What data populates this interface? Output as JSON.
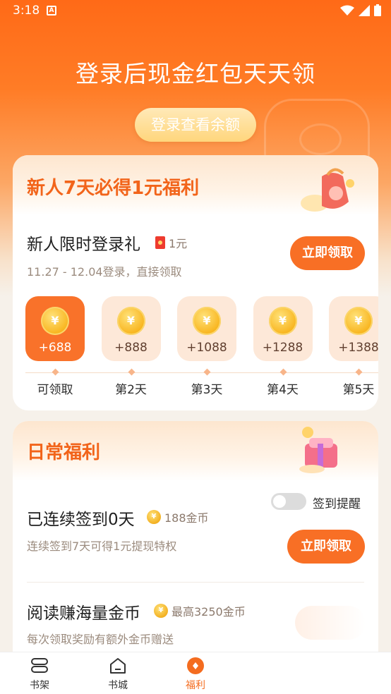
{
  "status_bar": {
    "time": "3:18"
  },
  "hero": {
    "title": "登录后现金红包天天领",
    "login_button": "登录查看余额"
  },
  "newbie": {
    "title": "新人7天必得1元福利",
    "task_title": "新人限时登录礼",
    "reward": "1元",
    "subtitle": "11.27 - 12.04登录，直接领取",
    "cta": "立即领取",
    "days": [
      {
        "amount": "+688",
        "label": "可领取",
        "active": true
      },
      {
        "amount": "+888",
        "label": "第2天",
        "active": false
      },
      {
        "amount": "+1088",
        "label": "第3天",
        "active": false
      },
      {
        "amount": "+1288",
        "label": "第4天",
        "active": false
      },
      {
        "amount": "+1388",
        "label": "第5天",
        "active": false
      }
    ]
  },
  "daily": {
    "title": "日常福利",
    "reminder_label": "签到提醒",
    "reminder_on": false,
    "checkin_title": "已连续签到0天",
    "checkin_reward": "188金币",
    "checkin_sub": "连续签到7天可得1元提现特权",
    "checkin_cta": "立即领取",
    "read_title": "阅读赚海量金币",
    "read_reward": "最高3250金币",
    "read_sub": "每次领取奖励有额外金币赠送"
  },
  "nav": {
    "items": [
      {
        "label": "书架",
        "icon": "bookshelf-icon"
      },
      {
        "label": "书城",
        "icon": "bookstore-icon"
      },
      {
        "label": "福利",
        "icon": "welfare-icon"
      }
    ],
    "active_index": 2,
    "accent": "#f46c1f"
  },
  "colors": {
    "primary": "#f86f25",
    "title_orange": "#f2641a"
  }
}
